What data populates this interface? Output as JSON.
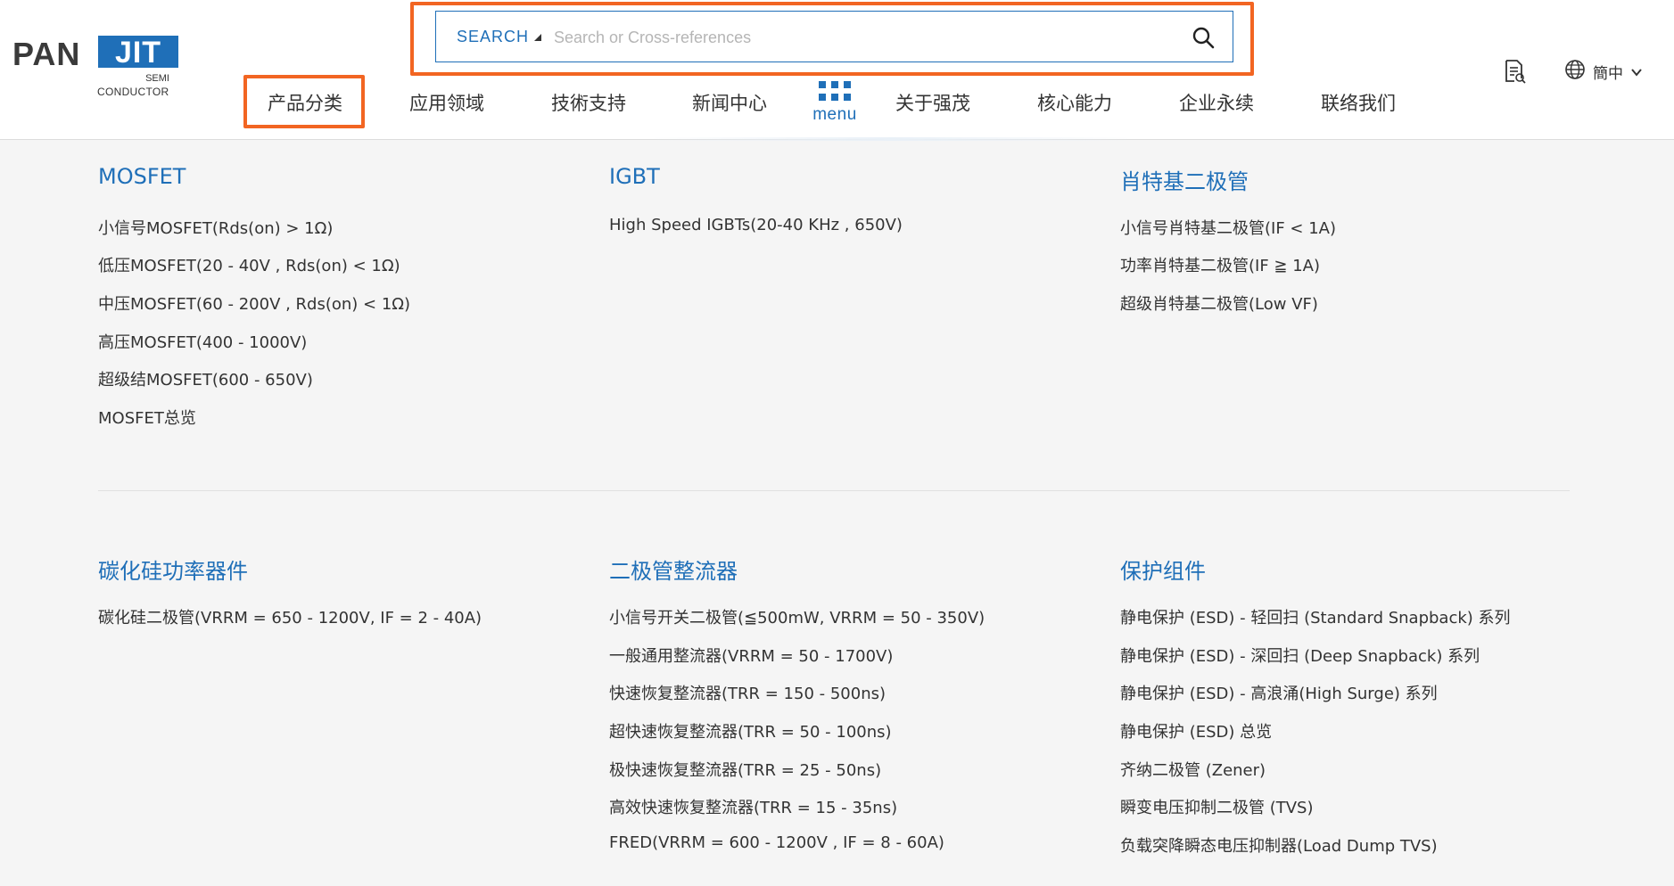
{
  "logo": {
    "pan": "PAN",
    "jit": "JIT",
    "semi": "SEMI",
    "conductor": "CONDUCTOR"
  },
  "search": {
    "type_label": "SEARCH",
    "placeholder": "Search or Cross-references"
  },
  "nav": {
    "items": [
      "产品分类",
      "应用领域",
      "技術支持",
      "新闻中心",
      "关于强茂",
      "核心能力",
      "企业永续",
      "联络我们"
    ],
    "menu_label": "menu",
    "language": "簡中"
  },
  "colors": {
    "accent": "#1f6fb8",
    "highlight": "#f26522"
  },
  "categories": [
    {
      "title": "MOSFET",
      "items": [
        "小信号MOSFET(Rds(on) > 1Ω)",
        "低压MOSFET(20 - 40V , Rds(on) < 1Ω)",
        "中压MOSFET(60 - 200V , Rds(on) < 1Ω)",
        "高压MOSFET(400 - 1000V)",
        "超级结MOSFET(600 - 650V)",
        "MOSFET总览"
      ]
    },
    {
      "title": "IGBT",
      "items": [
        "High Speed IGBTs(20-40 KHz , 650V)"
      ]
    },
    {
      "title": "肖特基二极管",
      "items": [
        "小信号肖特基二极管(IF < 1A)",
        "功率肖特基二极管(IF ≧ 1A)",
        "超级肖特基二极管(Low VF)"
      ]
    },
    {
      "title": "碳化硅功率器件",
      "items": [
        "碳化硅二极管(VRRM = 650 - 1200V, IF = 2 - 40A)"
      ]
    },
    {
      "title": "二极管整流器",
      "items": [
        "小信号开关二极管(≦500mW, VRRM = 50 - 350V)",
        "一般通用整流器(VRRM = 50 - 1700V)",
        "快速恢复整流器(TRR = 150 - 500ns)",
        "超快速恢复整流器(TRR = 50 - 100ns)",
        "极快速恢复整流器(TRR = 25 - 50ns)",
        "高效快速恢复整流器(TRR = 15 - 35ns)",
        "FRED(VRRM = 600 - 1200V , IF = 8 - 60A)"
      ]
    },
    {
      "title": "保护组件",
      "items": [
        "静电保护 (ESD) - 轻回扫 (Standard Snapback) 系列",
        "静电保护 (ESD) - 深回扫 (Deep Snapback) 系列",
        "静电保护 (ESD) - 高浪涌(High Surge) 系列",
        "静电保护 (ESD) 总览",
        "齐纳二极管 (Zener)",
        "瞬变电压抑制二极管 (TVS)",
        "负载突降瞬态电压抑制器(Load Dump TVS)"
      ]
    }
  ]
}
